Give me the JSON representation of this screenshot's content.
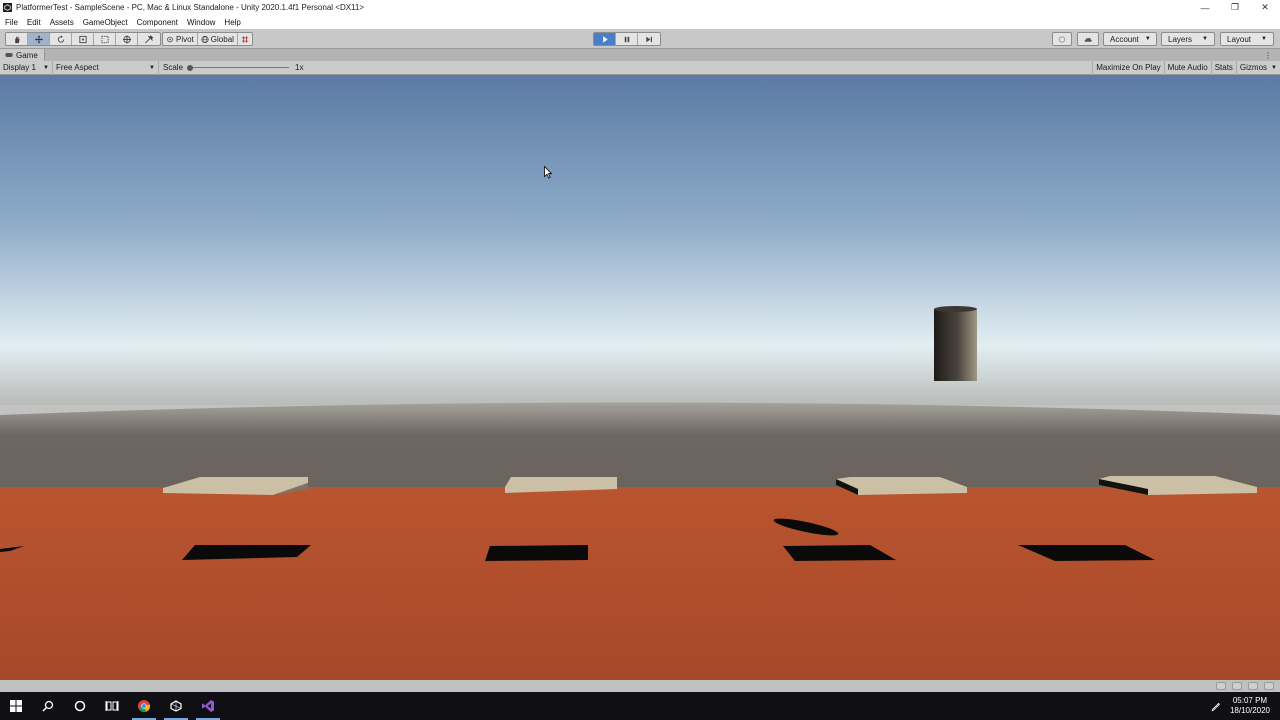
{
  "window": {
    "title": "PlatformerTest - SampleScene - PC, Mac & Linux Standalone - Unity 2020.1.4f1 Personal <DX11>",
    "controls": {
      "minimize": "—",
      "restore": "❐",
      "close": "✕"
    }
  },
  "menu": {
    "items": [
      "File",
      "Edit",
      "Assets",
      "GameObject",
      "Component",
      "Window",
      "Help"
    ]
  },
  "toolbar": {
    "tools": [
      {
        "name": "hand-tool",
        "icon": "hand-icon",
        "active": false
      },
      {
        "name": "move-tool",
        "icon": "move-icon",
        "active": true
      },
      {
        "name": "rotate-tool",
        "icon": "rotate-icon",
        "active": false
      },
      {
        "name": "scale-tool",
        "icon": "scale-icon",
        "active": false
      },
      {
        "name": "rect-tool",
        "icon": "rect-icon",
        "active": false
      },
      {
        "name": "transform-tool",
        "icon": "transform-icon",
        "active": false
      },
      {
        "name": "custom-tool",
        "icon": "tools-icon",
        "active": false
      }
    ],
    "pivot_label": "Pivot",
    "global_label": "Global",
    "playback": {
      "play_icon": "play-icon",
      "pause_icon": "pause-icon",
      "step_icon": "step-icon",
      "playing": true
    },
    "account_label": "Account",
    "layers_label": "Layers",
    "layout_label": "Layout"
  },
  "game_tab": {
    "label": "Game",
    "kebab": "⋮"
  },
  "game_controls": {
    "display": "Display 1",
    "aspect": "Free Aspect",
    "scale_label": "Scale",
    "scale_value": "1x",
    "buttons": {
      "maximize": "Maximize On Play",
      "mute": "Mute Audio",
      "stats": "Stats",
      "gizmos": "Gizmos"
    }
  },
  "scene": {
    "sky_top": "#5b7aa4",
    "sky_horizon": "#e3eef2",
    "ground_far": "#6e6761",
    "floor_color": "#b9552f",
    "platform_color": "#cbbfa6",
    "shadow_color": "#0a0a0a",
    "player_color": "#3a3530"
  },
  "taskbar": {
    "apps": [
      "windows-start",
      "search",
      "cortana",
      "task-view",
      "chrome",
      "unity",
      "visual-studio"
    ],
    "time": "05:07 PM",
    "date": "18/10/2020"
  }
}
